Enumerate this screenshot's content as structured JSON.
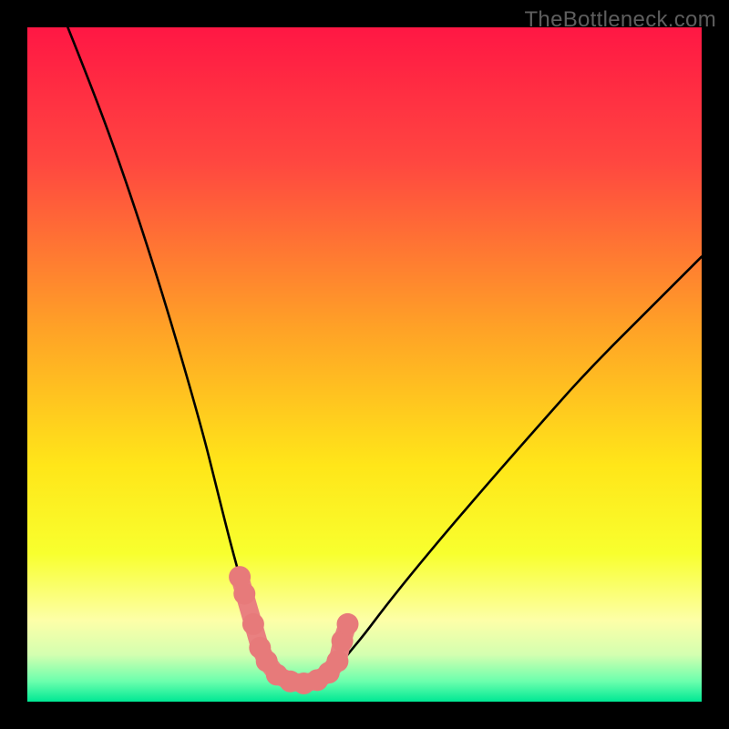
{
  "watermark": "TheBottleneck.com",
  "chart_data": {
    "type": "line",
    "title": "",
    "xlabel": "",
    "ylabel": "",
    "xlim": [
      0,
      100
    ],
    "ylim": [
      0,
      100
    ],
    "grid": false,
    "series": [
      {
        "name": "left-curve",
        "x": [
          6,
          10,
          14,
          18,
          22,
          26,
          28,
          30,
          31.5,
          33,
          34,
          35,
          36,
          37,
          38
        ],
        "y": [
          100,
          90,
          79,
          67,
          54,
          40,
          32,
          24,
          18.5,
          13,
          10,
          7.5,
          5.5,
          4,
          3
        ]
      },
      {
        "name": "right-curve",
        "x": [
          44,
          45,
          46,
          47.5,
          50,
          53,
          57,
          62,
          68,
          75,
          83,
          92,
          100
        ],
        "y": [
          3,
          4,
          5,
          7,
          10,
          14,
          19,
          25,
          32,
          40,
          49,
          58,
          66
        ]
      },
      {
        "name": "floor",
        "x": [
          38,
          40,
          42,
          44
        ],
        "y": [
          3,
          2.4,
          2.4,
          3
        ]
      }
    ],
    "markers": {
      "name": "highlighted-points",
      "points": [
        {
          "x": 31.5,
          "y": 18.5
        },
        {
          "x": 32.2,
          "y": 16
        },
        {
          "x": 33.5,
          "y": 11.5
        },
        {
          "x": 34.5,
          "y": 8
        },
        {
          "x": 35.5,
          "y": 6
        },
        {
          "x": 37,
          "y": 4
        },
        {
          "x": 39,
          "y": 3
        },
        {
          "x": 41,
          "y": 2.7
        },
        {
          "x": 43,
          "y": 3.2
        },
        {
          "x": 44.7,
          "y": 4.3
        },
        {
          "x": 46,
          "y": 6
        },
        {
          "x": 46.7,
          "y": 9
        },
        {
          "x": 47.5,
          "y": 11.5
        }
      ]
    },
    "bands": [
      {
        "name": "green-band",
        "y0": 0,
        "y1": 3
      },
      {
        "name": "light-yellow-band",
        "y0": 3,
        "y1": 24
      }
    ],
    "gradient_stops": [
      {
        "offset": 0,
        "color": "#ff1744"
      },
      {
        "offset": 20,
        "color": "#ff4740"
      },
      {
        "offset": 45,
        "color": "#ffa326"
      },
      {
        "offset": 65,
        "color": "#ffe619"
      },
      {
        "offset": 78,
        "color": "#f8ff2e"
      },
      {
        "offset": 88,
        "color": "#fdffa8"
      },
      {
        "offset": 93,
        "color": "#d4ffb0"
      },
      {
        "offset": 97,
        "color": "#6bffad"
      },
      {
        "offset": 100,
        "color": "#00e894"
      }
    ]
  }
}
